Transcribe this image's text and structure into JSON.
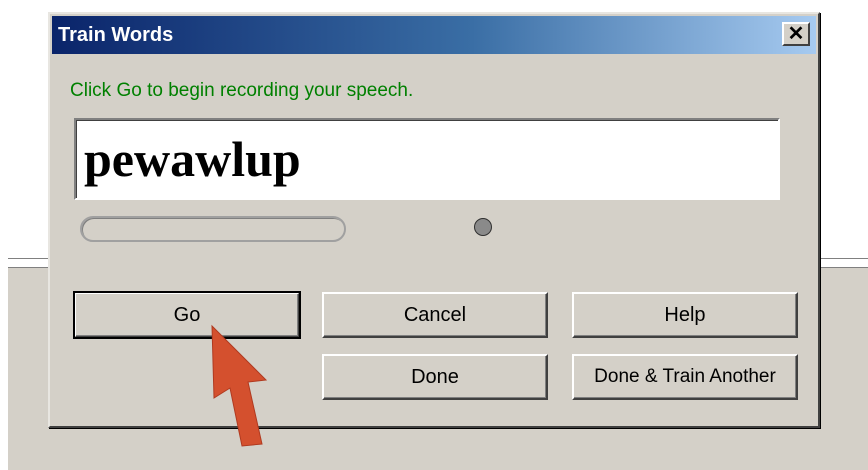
{
  "dialog": {
    "title": "Train Words",
    "close_icon": "close-x-icon",
    "instruction": "Click Go to begin recording your speech.",
    "word": "pewawlup",
    "progress": 0,
    "indicator_color": "#8a8a8a"
  },
  "buttons": {
    "go": "Go",
    "cancel": "Cancel",
    "help": "Help",
    "done": "Done",
    "done_train_another": "Done & Train Another"
  },
  "annotation": {
    "arrow_icon": "red-arrow-pointer",
    "arrow_color": "#d4502e"
  }
}
